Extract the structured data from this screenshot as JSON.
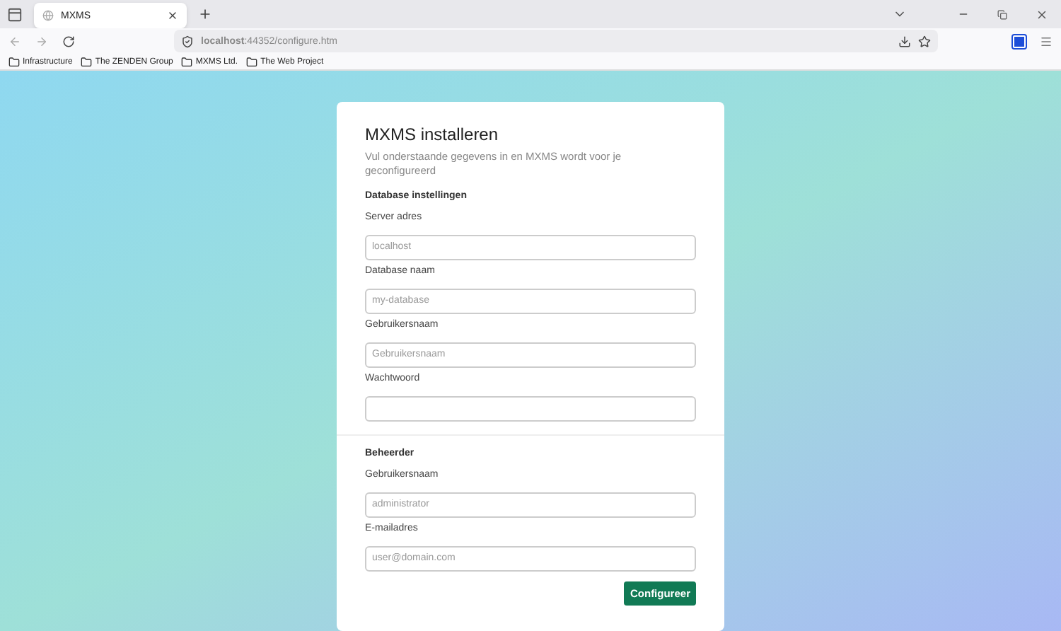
{
  "browser": {
    "tab": {
      "title": "MXMS",
      "selected": true
    },
    "address": "**localhost**:44352/configure.htm",
    "bookmarks": [
      "Infrastructure",
      "The ZENDEN Group",
      "MXMS Ltd.",
      "The Web Project"
    ]
  },
  "form": {
    "title": "MXMS installeren",
    "subtitle": "Vul onderstaande gegevens in en MXMS wordt voor je geconfigureerd",
    "sections": [
      {
        "heading": "Database instellingen",
        "fields": [
          {
            "label": "Server adres",
            "placeholder": "localhost"
          },
          {
            "label": "Database naam",
            "placeholder": "my-database"
          },
          {
            "label": "Gebruikersnaam",
            "placeholder": "Gebruikersnaam"
          },
          {
            "label": "Wachtwoord"
          }
        ]
      },
      {
        "heading": "Beheerder",
        "fields": [
          {
            "label": "Gebruikersnaam",
            "placeholder": "administrator"
          },
          {
            "label": "E-mailadres",
            "placeholder": "user@domain.com"
          }
        ]
      }
    ],
    "submit": "Configureer"
  }
}
